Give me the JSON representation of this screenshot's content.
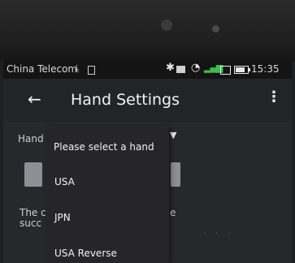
{
  "status_bar": {
    "carrier": "China Telecom",
    "time": "15:35",
    "battery_level": 0.75
  },
  "app_bar": {
    "title": "Hand Settings"
  },
  "content": {
    "hand_label_visible": "Hand",
    "description_line1_visible": "The c",
    "description_line2_visible": "succ",
    "description_fragment_right": "e"
  },
  "dropdown": {
    "header": "Please select a hand",
    "options": [
      "USA",
      "JPN",
      "USA Reverse"
    ]
  },
  "icons": {
    "back": "arrow-left-icon",
    "overflow": "more-vert-icon",
    "download": "download-icon",
    "bluetooth": "bluetooth-icon",
    "wifi": "wifi-icon",
    "signal": "signal-4g-icon",
    "battery": "battery-icon"
  }
}
